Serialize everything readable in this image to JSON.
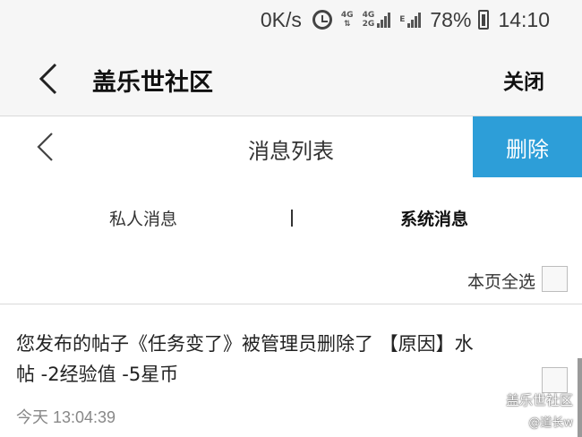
{
  "status_bar": {
    "speed": "0K/s",
    "net1_top": "4G",
    "net1_bottom": "⇅",
    "net2_top": "4G",
    "net2_bottom": "2G",
    "net3_top": "E",
    "battery": "78%",
    "time": "14:10"
  },
  "app_bar": {
    "title": "盖乐世社区",
    "close_label": "关闭"
  },
  "page_header": {
    "title": "消息列表",
    "delete_label": "删除"
  },
  "tabs": {
    "private": "私人消息",
    "separator": "|",
    "system": "系统消息",
    "active": "system"
  },
  "select_all": {
    "label": "本页全选",
    "checked": false
  },
  "messages": [
    {
      "text": "您发布的帖子《任务变了》被管理员删除了 【原因】水帖 -2经验值 -5星币",
      "time": "今天 13:04:39",
      "checked": false
    }
  ],
  "watermark": {
    "line1": "盖乐世社区",
    "line2": "@道长w"
  },
  "colors": {
    "accent": "#2d9ed8",
    "header_bg": "#f6f6f6",
    "text": "#222222",
    "muted": "#888888"
  }
}
